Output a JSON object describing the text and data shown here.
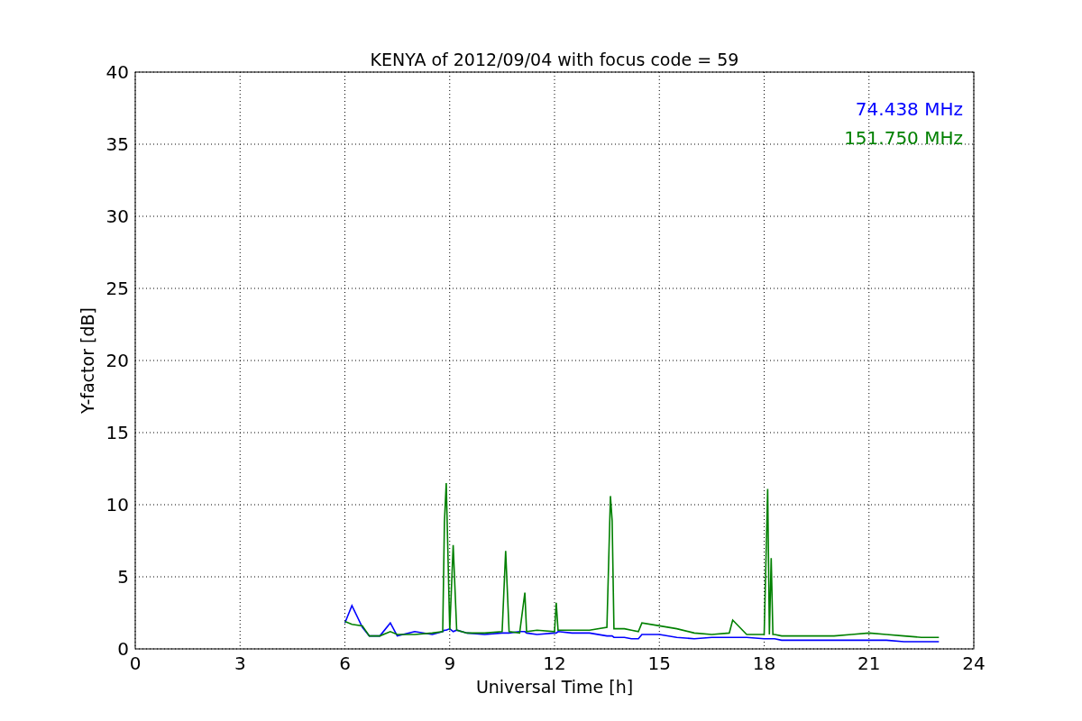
{
  "chart_data": {
    "type": "line",
    "title": "KENYA of 2012/09/04 with focus code = 59",
    "xlabel": "Universal Time [h]",
    "ylabel": "Y-factor [dB]",
    "x": [
      6.0,
      6.2,
      6.5,
      6.7,
      7.0,
      7.3,
      7.5,
      8.0,
      8.5,
      8.8,
      8.85,
      8.9,
      9.0,
      9.1,
      9.2,
      9.5,
      10.0,
      10.5,
      10.6,
      10.7,
      11.0,
      11.15,
      11.2,
      11.5,
      12.0,
      12.05,
      12.1,
      12.5,
      13.0,
      13.5,
      13.6,
      13.65,
      13.7,
      14.0,
      14.2,
      14.4,
      14.5,
      15.0,
      15.5,
      16.0,
      16.5,
      17.0,
      17.1,
      17.5,
      18.0,
      18.1,
      18.15,
      18.2,
      18.25,
      18.3,
      18.5,
      19.0,
      19.5,
      20.0,
      20.5,
      21.0,
      21.5,
      22.0,
      22.5,
      23.0
    ],
    "series": [
      {
        "name": "74.438 MHz",
        "color": "#0000ff",
        "values": [
          1.8,
          3.0,
          1.5,
          0.9,
          0.9,
          1.8,
          0.9,
          1.2,
          1.0,
          1.2,
          1.3,
          1.3,
          1.4,
          1.2,
          1.3,
          1.1,
          1.0,
          1.1,
          1.1,
          1.1,
          1.2,
          1.2,
          1.1,
          1.0,
          1.1,
          1.1,
          1.2,
          1.1,
          1.1,
          0.9,
          0.9,
          0.9,
          0.8,
          0.8,
          0.7,
          0.7,
          1.0,
          1.0,
          0.8,
          0.7,
          0.8,
          0.8,
          0.8,
          0.8,
          0.7,
          0.7,
          0.7,
          0.7,
          0.7,
          0.7,
          0.6,
          0.6,
          0.6,
          0.6,
          0.6,
          0.6,
          0.6,
          0.5,
          0.5,
          0.5
        ]
      },
      {
        "name": "151.750 MHz",
        "color": "#008000",
        "values": [
          1.9,
          1.7,
          1.6,
          0.9,
          0.9,
          1.2,
          1.0,
          1.0,
          1.1,
          1.2,
          8.8,
          11.5,
          1.3,
          7.2,
          1.3,
          1.1,
          1.1,
          1.2,
          6.8,
          1.2,
          1.1,
          3.9,
          1.2,
          1.3,
          1.2,
          3.2,
          1.3,
          1.3,
          1.3,
          1.5,
          10.6,
          8.9,
          1.4,
          1.4,
          1.3,
          1.2,
          1.8,
          1.6,
          1.4,
          1.1,
          1.0,
          1.1,
          2.0,
          1.0,
          1.0,
          11.1,
          1.0,
          6.3,
          1.0,
          1.0,
          0.9,
          0.9,
          0.9,
          0.9,
          1.0,
          1.1,
          1.0,
          0.9,
          0.8,
          0.8
        ]
      }
    ],
    "xlim": [
      0,
      24
    ],
    "ylim": [
      0,
      40
    ],
    "xticks": [
      0,
      3,
      6,
      9,
      12,
      15,
      18,
      21,
      24
    ],
    "yticks": [
      0,
      5,
      10,
      15,
      20,
      25,
      30,
      35,
      40
    ],
    "grid": true
  }
}
